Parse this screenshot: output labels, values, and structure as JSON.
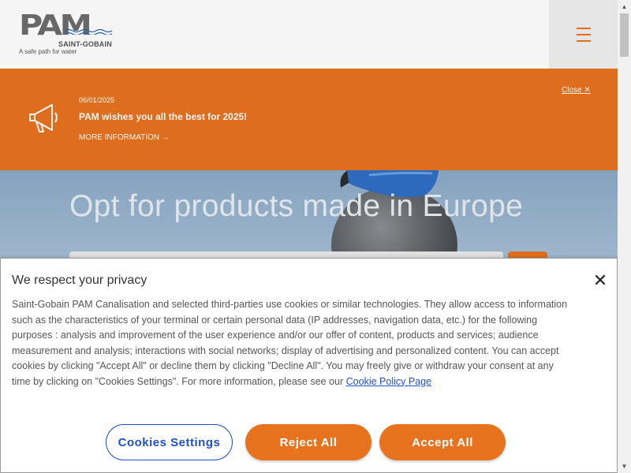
{
  "header": {
    "logo_text": "PAM",
    "logo_company": "SAINT-GOBAIN",
    "logo_tagline": "A safe path for water",
    "menu_icon": "hamburger-menu-icon"
  },
  "banner": {
    "icon": "megaphone-icon",
    "date": "06/01/2025",
    "title": "PAM wishes you all the best for 2025!",
    "more_label": "MORE INFORMATION →",
    "close_label": "Close ✕"
  },
  "hero": {
    "title": "Opt for products made in Europe"
  },
  "cookie": {
    "title": "We respect your privacy",
    "close_glyph": "✕",
    "body": "Saint-Gobain PAM Canalisation and selected third-parties use cookies or similar technologies. They allow access to information such as the characteristics of your terminal or certain personal data (IP addresses, navigation data, etc.) for the following purposes : analysis and improvement of the user experience and/or our offer of content, products and services; audience measurement and analysis; interactions with social networks; display of advertising and personalized content. You can accept cookies by clicking \"Accept All\" or decline them by clicking \"Decline All\". You may freely give or withdraw your consent at any time by clicking on \"Cookies Settings\". For more information, please see our ",
    "policy_link": "Cookie Policy Page",
    "settings_label": "Cookies Settings",
    "reject_label": "Reject All",
    "accept_label": "Accept All"
  },
  "colors": {
    "accent": "#e8731f",
    "link": "#1e50c8"
  }
}
